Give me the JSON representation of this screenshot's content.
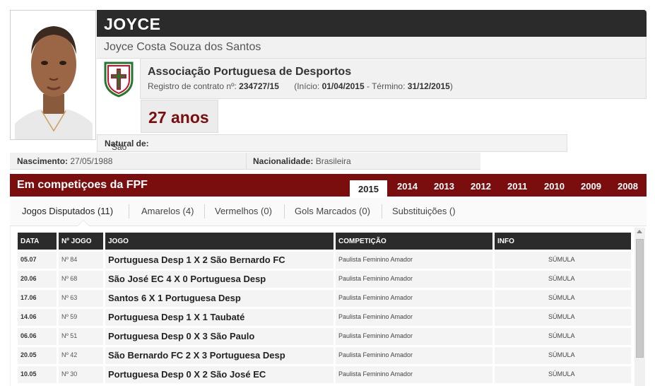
{
  "player": {
    "nickname": "JOYCE",
    "fullname": "Joyce Costa Souza dos Santos",
    "age": "27 anos",
    "natural_label": "Natural de:",
    "natural_value": "São Paulo",
    "birth_label": "Nascimento:",
    "birth_value": "27/05/1988",
    "nationality_label": "Nacionalidade:",
    "nationality_value": "Brasileira"
  },
  "club": {
    "name": "Associação Portuguesa de Desportos",
    "reg_label": "Registro de contrato nº:",
    "reg_number": "234727/15",
    "start_label": "(Início:",
    "start_date": "01/04/2015",
    "end_label": "- Término:",
    "end_date": "31/12/2015",
    "end_close": ")"
  },
  "competitions": {
    "title": "Em competiçoes da FPF",
    "years": [
      "2015",
      "2014",
      "2013",
      "2012",
      "2011",
      "2010",
      "2009",
      "2008"
    ],
    "active_year": "2015"
  },
  "stat_tabs": [
    "Jogos Disputados (11)",
    "Amarelos (4)",
    "Vermelhos (0)",
    "Gols Marcados (0)",
    "Substituições ()"
  ],
  "table": {
    "headers": [
      "DATA",
      "Nº JOGO",
      "JOGO",
      "COMPETIÇÃO",
      "INFO"
    ],
    "rows": [
      {
        "date": "05.07",
        "num": "Nº 84",
        "game": "Portuguesa Desp 1 X 2 São Bernardo FC",
        "comp": "Paulista Feminino Amador",
        "info": "SÚMULA"
      },
      {
        "date": "20.06",
        "num": "Nº 68",
        "game": "São José EC 4 X 0 Portuguesa Desp",
        "comp": "Paulista Feminino Amador",
        "info": "SÚMULA"
      },
      {
        "date": "17.06",
        "num": "Nº 63",
        "game": "Santos 6 X 1 Portuguesa Desp",
        "comp": "Paulista Feminino Amador",
        "info": "SÚMULA"
      },
      {
        "date": "14.06",
        "num": "Nº 59",
        "game": "Portuguesa Desp 1 X 1 Taubaté",
        "comp": "Paulista Feminino Amador",
        "info": "SÚMULA"
      },
      {
        "date": "06.06",
        "num": "Nº 51",
        "game": "Portuguesa Desp 0 X 3 São Paulo",
        "comp": "Paulista Feminino Amador",
        "info": "SÚMULA"
      },
      {
        "date": "20.05",
        "num": "Nº 42",
        "game": "São Bernardo FC 2 X 3 Portuguesa Desp",
        "comp": "Paulista Feminino Amador",
        "info": "SÚMULA"
      },
      {
        "date": "10.05",
        "num": "Nº 30",
        "game": "Portuguesa Desp 0 X 2 São José EC",
        "comp": "Paulista Feminino Amador",
        "info": "SÚMULA"
      }
    ]
  },
  "colors": {
    "brand_red": "#7a0d0d",
    "dark_header": "#2b2b2b",
    "age_text": "#7a0e0e"
  }
}
